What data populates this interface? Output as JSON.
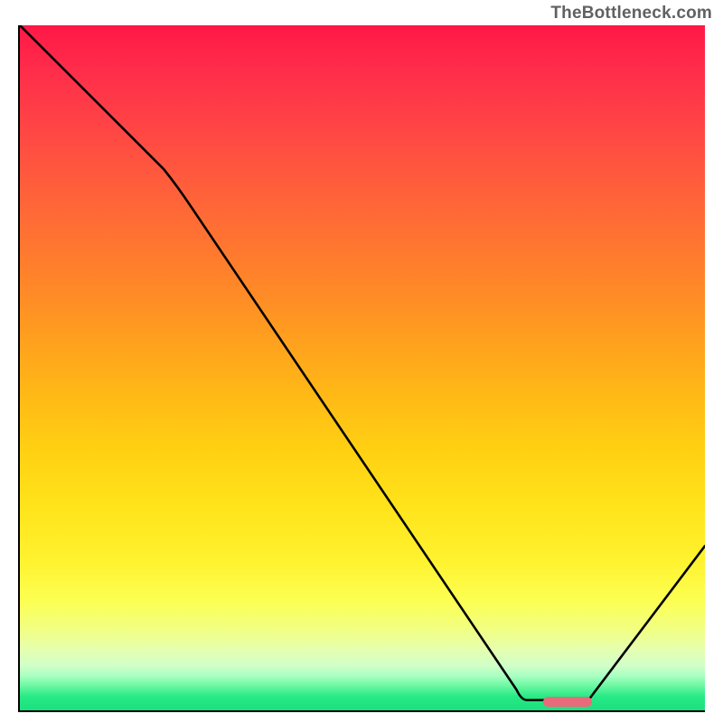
{
  "attribution": "TheBottleneck.com",
  "chart_data": {
    "type": "line",
    "title": "",
    "xlabel": "",
    "ylabel": "",
    "xlim": [
      0,
      100
    ],
    "ylim": [
      0,
      100
    ],
    "series": [
      {
        "name": "curve",
        "points": [
          {
            "x": 0,
            "y": 100
          },
          {
            "x": 21,
            "y": 79
          },
          {
            "x": 25,
            "y": 73.5
          },
          {
            "x": 72.5,
            "y": 3
          },
          {
            "x": 74,
            "y": 1.5
          },
          {
            "x": 76.5,
            "y": 1.5
          },
          {
            "x": 83,
            "y": 1.5
          },
          {
            "x": 100,
            "y": 24
          }
        ]
      }
    ],
    "marker": {
      "x_start": 76.5,
      "x_end": 83,
      "y": 1.5
    },
    "gradient_stops": [
      {
        "pos": 0,
        "color": "#ff1846"
      },
      {
        "pos": 50,
        "color": "#ffb000"
      },
      {
        "pos": 80,
        "color": "#fff22e"
      },
      {
        "pos": 100,
        "color": "#19e07e"
      }
    ]
  }
}
